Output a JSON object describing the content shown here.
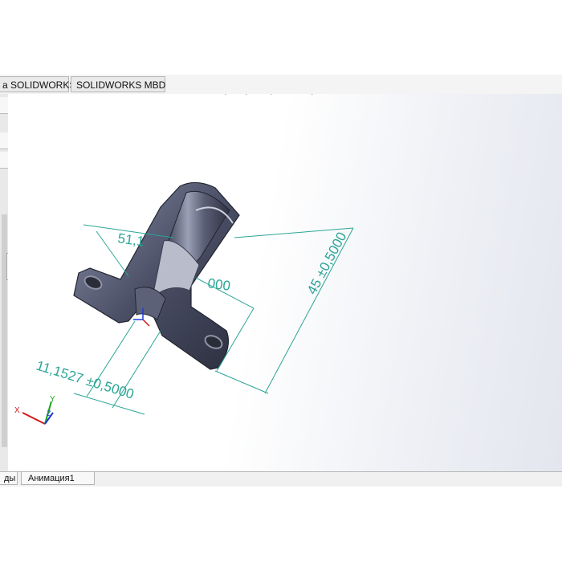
{
  "tabs": [
    "а SOLIDWORKS",
    "SOLIDWORKS MBD"
  ],
  "bottom_tabs": [
    "ды",
    "Анимация1"
  ],
  "headsup_toolbar": [
    "zoom-to-fit-icon",
    "zoom-to-area-icon",
    "previous-view-icon",
    "section-view-icon",
    "dynamic-annotation-icon",
    "view-orientation-icon",
    "display-style-icon",
    "hide-show-icon",
    "edit-appearance-icon",
    "apply-scene-icon",
    "view-settings-icon"
  ],
  "dimensions": {
    "d1": "51,1",
    "d2": "000",
    "d3": "45 ±0,5000",
    "d4": "11,1527 ±0,5000"
  },
  "triad": {
    "x": "X",
    "y": "Y",
    "z": "Z"
  },
  "colors": {
    "dimension": "#2aa596",
    "part": "#4a4f63",
    "background": "#ffffff"
  }
}
